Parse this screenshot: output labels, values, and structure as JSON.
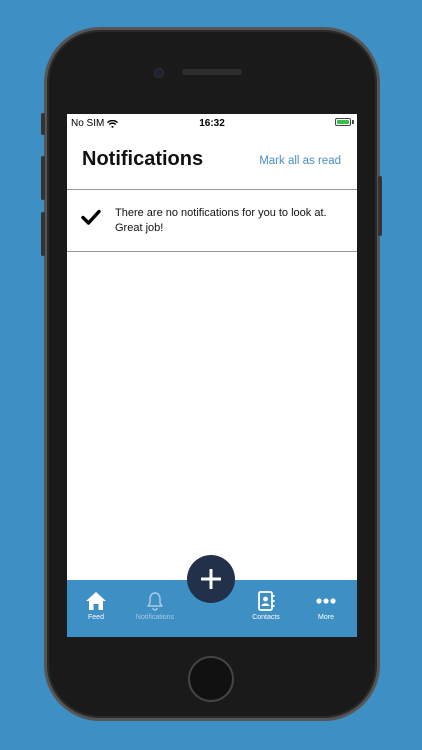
{
  "status": {
    "carrier": "No SIM",
    "time": "16:32",
    "icons": [
      "wifi-icon",
      "battery-icon"
    ]
  },
  "header": {
    "title": "Notifications",
    "mark_all_label": "Mark all as read"
  },
  "notification": {
    "icon": "check-icon",
    "text": "There are no notifications for you to look at. Great job!"
  },
  "tabs": [
    {
      "label": "Feed",
      "icon": "home-icon"
    },
    {
      "label": "Notifications",
      "icon": "bell-icon"
    },
    {
      "label": "Contacts",
      "icon": "contacts-icon"
    },
    {
      "label": "More",
      "icon": "more-icon"
    }
  ],
  "fab": {
    "icon": "plus-icon"
  },
  "colors": {
    "background": "#3d8fc4",
    "tabbar": "#3d8fc4",
    "fab": "#22304a",
    "accent_link": "#4a90c4"
  }
}
